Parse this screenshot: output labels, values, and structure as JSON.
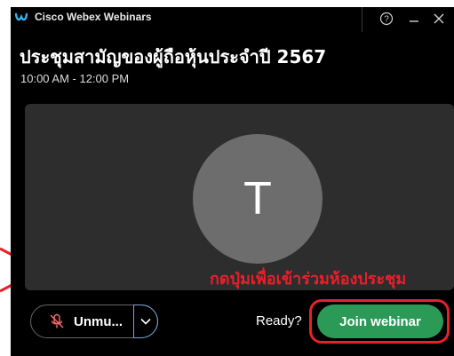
{
  "app": {
    "name": "Cisco Webex Webinars"
  },
  "title_controls": {
    "help_glyph": "?",
    "minimize_glyph": "–",
    "close_glyph": "✕"
  },
  "meeting": {
    "title": "ประชุมสามัญของผู้ถือหุ้นประจำปี 2567",
    "time": "10:00 AM - 12:00 PM"
  },
  "preview": {
    "avatar_initial": "T"
  },
  "annotation": {
    "instruction": "กดปุ่มเพื่อเข้าร่วมห้องประชุม",
    "color": "#e8202a"
  },
  "bottom_bar": {
    "unmute_label": "Unmu...",
    "ready_text": "Ready?",
    "join_label": "Join webinar"
  },
  "colors": {
    "background": "#000000",
    "preview_bg": "#2d2d2d",
    "avatar_bg": "#6d6d6d",
    "join_green": "#2c9a57",
    "annotation_red": "#e8202a"
  },
  "icons": {
    "app_logo": "webex-logo-icon",
    "help": "help-icon",
    "minimize": "minimize-icon",
    "close": "close-icon",
    "mic": "mic-muted-icon",
    "caret": "chevron-down-icon"
  }
}
